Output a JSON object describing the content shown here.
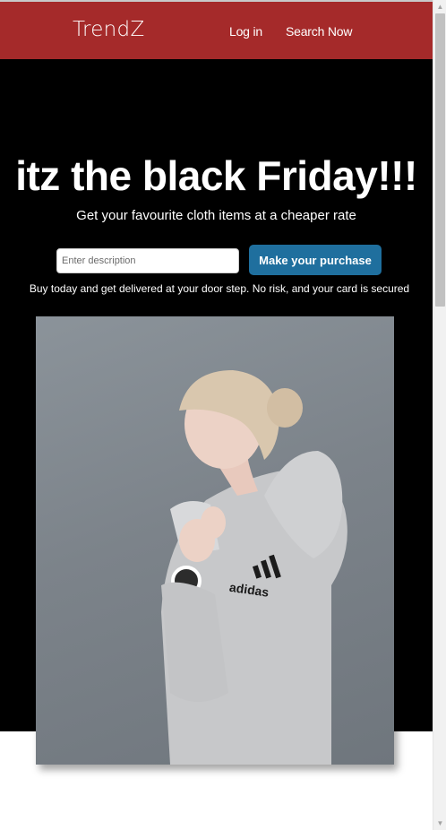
{
  "navbar": {
    "brand": "TrendZ",
    "links": [
      {
        "label": "Log in"
      },
      {
        "label": "Search Now"
      }
    ]
  },
  "hero": {
    "title": "itz the black Friday!!!",
    "subtitle": "Get your favourite cloth items at a cheaper rate",
    "search": {
      "placeholder": "Enter description",
      "value": ""
    },
    "cta_label": "Make your purchase",
    "note": "Buy today and get delivered at your door step. No risk, and your card is secured"
  },
  "image": {
    "logo_text": "adidas"
  },
  "colors": {
    "navbar_bg": "#a52a2a",
    "hero_bg": "#000000",
    "cta_bg": "#1f6f9e"
  },
  "scrollbar": {
    "up_icon": "triangle-up",
    "down_icon": "triangle-down"
  }
}
